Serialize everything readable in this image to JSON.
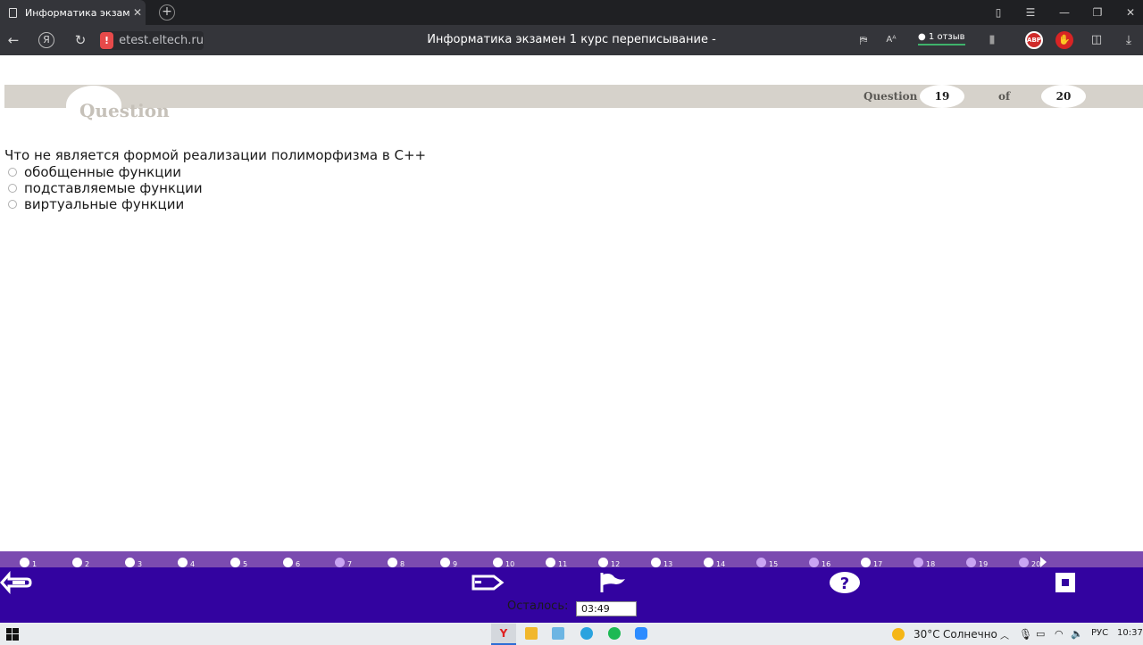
{
  "browser": {
    "tab_title": "Информатика экзамен",
    "address": "etest.eltech.ru",
    "page_title": "Информатика экзамен 1 курс переписывание -",
    "reviews_label": "1 отзыв",
    "abp_label": "ABP"
  },
  "quiz": {
    "header": {
      "logo_text": "Question",
      "question_label": "Question",
      "current": "19",
      "of_label": "of",
      "total": "20"
    },
    "question_text": "Что не является формой реализации полиморфизма в С++",
    "options": [
      "обобщенные функции",
      "подставляемые функции",
      "виртуальные функции"
    ],
    "progress": {
      "current_index": 19,
      "items": [
        {
          "n": "1",
          "state": "answered"
        },
        {
          "n": "2",
          "state": "answered"
        },
        {
          "n": "3",
          "state": "answered"
        },
        {
          "n": "4",
          "state": "answered"
        },
        {
          "n": "5",
          "state": "answered"
        },
        {
          "n": "6",
          "state": "answered"
        },
        {
          "n": "7",
          "state": "unanswered"
        },
        {
          "n": "8",
          "state": "answered"
        },
        {
          "n": "9",
          "state": "answered"
        },
        {
          "n": "10",
          "state": "answered"
        },
        {
          "n": "11",
          "state": "answered"
        },
        {
          "n": "12",
          "state": "answered"
        },
        {
          "n": "13",
          "state": "answered"
        },
        {
          "n": "14",
          "state": "answered"
        },
        {
          "n": "15",
          "state": "unanswered"
        },
        {
          "n": "16",
          "state": "unanswered"
        },
        {
          "n": "17",
          "state": "answered"
        },
        {
          "n": "18",
          "state": "unanswered"
        },
        {
          "n": "19",
          "state": "unanswered"
        },
        {
          "n": "20",
          "state": "unanswered"
        }
      ]
    },
    "timer": {
      "label": "Осталось:",
      "value": "03:49"
    }
  },
  "taskbar": {
    "temperature": "30°C",
    "weather": "Солнечно",
    "language": "РУС",
    "time": "10:37"
  },
  "colors": {
    "progress_bg": "#7b4bb0",
    "controls_bg": "#3303a0",
    "answered": "#ffffff",
    "unanswered": "#c9a4f3",
    "header_band": "#d6d2cb"
  }
}
